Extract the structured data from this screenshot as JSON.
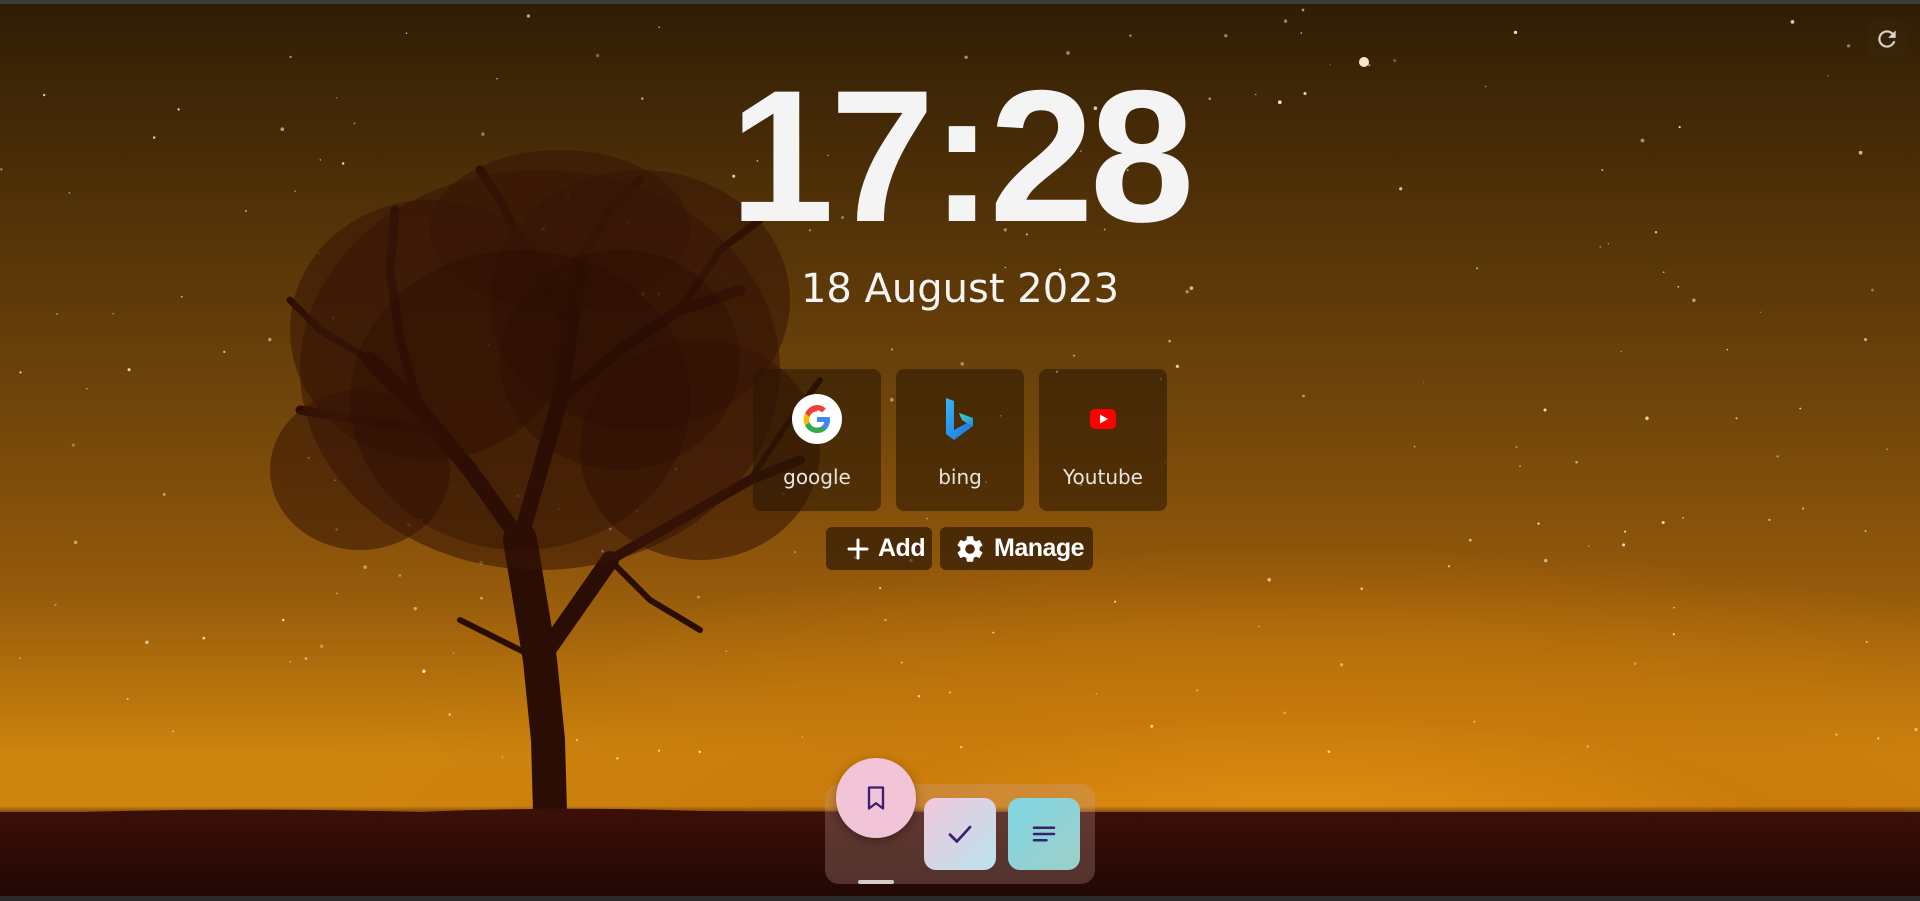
{
  "clock": {
    "time": "17:28"
  },
  "date": {
    "text": "18 August 2023"
  },
  "shortcuts": [
    {
      "label": "google",
      "icon": "google-icon"
    },
    {
      "label": "bing",
      "icon": "bing-icon"
    },
    {
      "label": "Youtube",
      "icon": "youtube-icon"
    }
  ],
  "actions": {
    "add_label": "Add",
    "add_icon": "plus-icon",
    "manage_label": "Manage",
    "manage_icon": "gear-icon"
  },
  "toolbar": {
    "refresh_icon": "refresh-icon"
  },
  "dock": {
    "items": [
      {
        "icon": "bookmark-icon",
        "color": "#f2c4d8",
        "active": true
      },
      {
        "icon": "check-icon",
        "color": "#b8e6ec"
      },
      {
        "icon": "notes-icon",
        "color": "#8fd3dc"
      }
    ]
  },
  "colors": {
    "accent_purple": "#3b1f6e",
    "text": "#f4f4f4"
  }
}
